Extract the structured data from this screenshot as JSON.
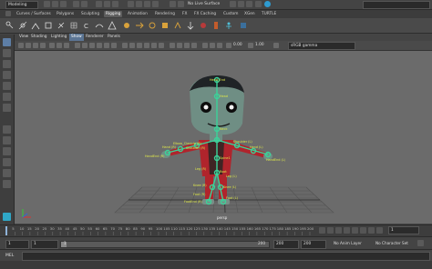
{
  "status": {
    "mode": "Modeling",
    "live_surface": "No Live Surface"
  },
  "shelf_tabs": [
    "Curves / Surfaces",
    "Polygons",
    "Sculpting",
    "Rigging",
    "Animation",
    "Rendering",
    "FX",
    "FX Caching",
    "Custom",
    "XGen",
    "TURTLE"
  ],
  "active_shelf_tab": "Rigging",
  "panel_menus": [
    "View",
    "Shading",
    "Lighting",
    "Show",
    "Renderer",
    "Panels"
  ],
  "active_panel_menu": "Show",
  "panel_toolbar": {
    "value_a": "0.00",
    "value_b": "1.00",
    "color_space": "sRGB gamma"
  },
  "viewport": {
    "camera": "persp",
    "joint_labels": [
      "Head_End",
      "Head",
      "Neck",
      "Elbow_Clavicle (R)",
      "Shoulder (R)",
      "Shoulder (L)",
      "Hand (R)",
      "Hand (L)",
      "HandEnd (R)",
      "HandEnd (L)",
      "Spine1",
      "Root",
      "Leg (R)",
      "Leg (L)",
      "Knee (R)",
      "Knee (L)",
      "Foot (R)",
      "Foot (L)",
      "FootEnd (R)"
    ]
  },
  "timeline": {
    "ticks": [
      "5",
      "10",
      "15",
      "20",
      "25",
      "30",
      "35",
      "40",
      "45",
      "50",
      "55",
      "60",
      "65",
      "70",
      "75",
      "80",
      "85",
      "90",
      "95",
      "100",
      "105",
      "110",
      "115",
      "120",
      "125",
      "130",
      "135",
      "140",
      "145",
      "150",
      "155",
      "160",
      "165",
      "170",
      "175",
      "180",
      "185",
      "190",
      "195",
      "200"
    ],
    "current_frame": "1"
  },
  "range": {
    "start": "1",
    "inner_start": "1",
    "slider_start": "1",
    "slider_end": "200",
    "inner_end": "200",
    "end": "200",
    "anim_layer": "No Anim Layer",
    "character_set": "No Character Set"
  },
  "command": {
    "lang": "MEL"
  },
  "colors": {
    "accent": "#5d7ea6",
    "joint": "#3ad39a",
    "label": "#dfe94a",
    "body_red": "#b0242c",
    "skin": "#6f8e84",
    "grid": "#525252"
  }
}
